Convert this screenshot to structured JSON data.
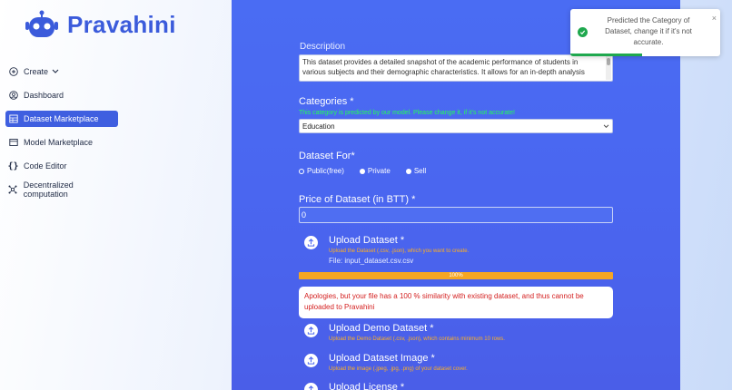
{
  "app": {
    "name": "Pravahini"
  },
  "sidebar": {
    "items": [
      {
        "label": "Create",
        "icon": "plus-circle-icon"
      },
      {
        "label": "Dashboard",
        "icon": "user-circle-icon"
      },
      {
        "label": "Dataset Marketplace",
        "icon": "table-icon",
        "active": true
      },
      {
        "label": "Model Marketplace",
        "icon": "model-icon"
      },
      {
        "label": "Code Editor",
        "icon": "braces-icon"
      },
      {
        "label": "Decentralized computation",
        "icon": "network-icon"
      }
    ]
  },
  "form": {
    "description_label": "Description",
    "description_value": "This dataset provides a detailed snapshot of the academic performance of students in various subjects and their demographic characteristics. It allows for an in-depth analysis",
    "categories_label": "Categories *",
    "categories_hint": "This category is predicted by our model. Please change it, if it's not accurate!",
    "category_selected": "Education",
    "dataset_for_label": "Dataset For*",
    "dataset_for_options": [
      "Public(free)",
      "Private",
      "Sell"
    ],
    "dataset_for_selected": "Public(free)",
    "price_label": "Price of Dataset (in BTT) *",
    "price_value": "0",
    "upload_dataset": {
      "title": "Upload Dataset *",
      "hint": "Upload the Dataset (.csv, .json), which you want to create.",
      "file": "File: input_dataset.csv.csv"
    },
    "progress": {
      "value": 100,
      "label": "100%"
    },
    "error": "Apologies, but your file has a 100 % similarity with existing dataset, and thus cannot be uploaded to Pravahini",
    "upload_demo": {
      "title": "Upload Demo Dataset *",
      "hint": "Upload the Demo Dataset (.csv, .json), which contains minimum 10 rows."
    },
    "upload_image": {
      "title": "Upload Dataset Image *",
      "hint": "Upload the image (.jpeg, .jpg, .png) of your dataset cover."
    },
    "upload_license": {
      "title": "Upload License *"
    }
  },
  "toast": {
    "message": "Predicted the Category of Dataset, change it if it's not accurate.",
    "close": "×",
    "progress_fraction": 0.48
  },
  "colors": {
    "accent": "#3f5fe0",
    "panel": "#4a66f0",
    "success": "#1fa84e",
    "warning": "#f5a623",
    "error": "#d42020"
  }
}
